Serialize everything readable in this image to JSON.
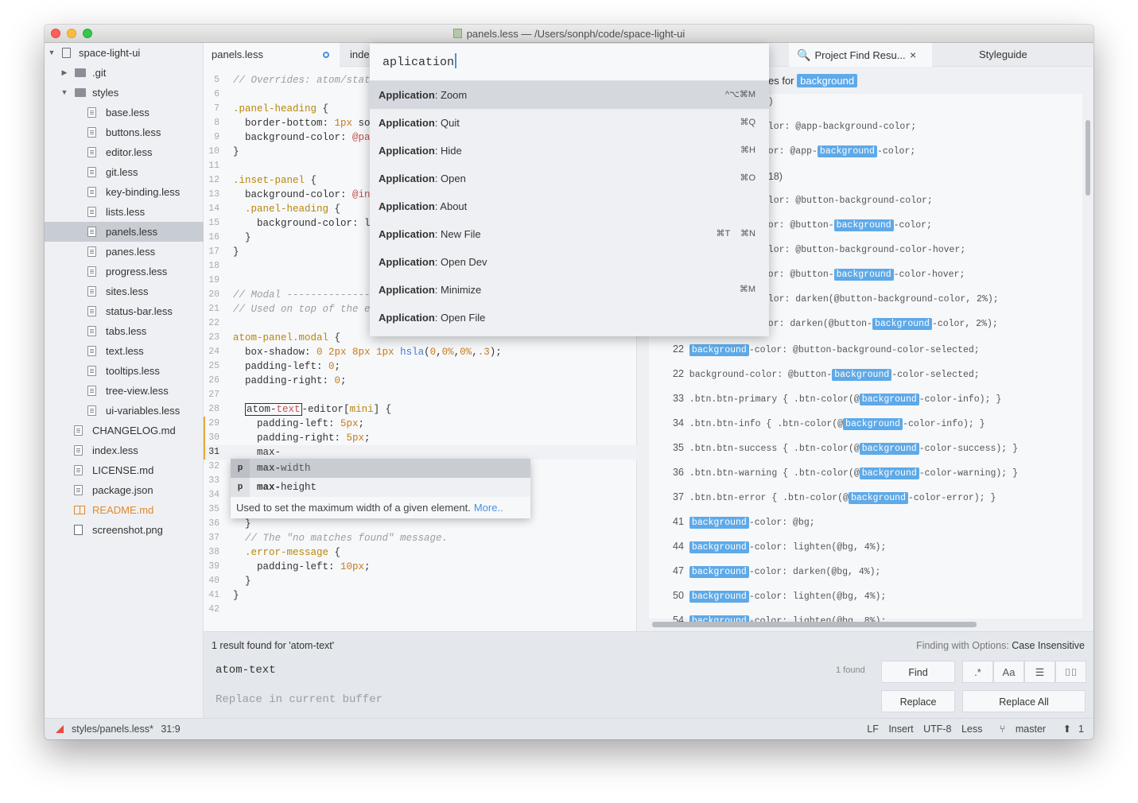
{
  "window": {
    "title": "panels.less — /Users/sonph/code/space-light-ui"
  },
  "sidebar": {
    "root": "space-light-ui",
    "items": [
      {
        "label": ".git",
        "kind": "folder",
        "depth": 1,
        "chev": "▶"
      },
      {
        "label": "styles",
        "kind": "folder",
        "depth": 1,
        "chev": "▼"
      },
      {
        "label": "base.less",
        "kind": "file",
        "depth": 2
      },
      {
        "label": "buttons.less",
        "kind": "file",
        "depth": 2
      },
      {
        "label": "editor.less",
        "kind": "file",
        "depth": 2
      },
      {
        "label": "git.less",
        "kind": "file",
        "depth": 2
      },
      {
        "label": "key-binding.less",
        "kind": "file",
        "depth": 2
      },
      {
        "label": "lists.less",
        "kind": "file",
        "depth": 2
      },
      {
        "label": "panels.less",
        "kind": "file",
        "depth": 2,
        "selected": true
      },
      {
        "label": "panes.less",
        "kind": "file",
        "depth": 2
      },
      {
        "label": "progress.less",
        "kind": "file",
        "depth": 2
      },
      {
        "label": "sites.less",
        "kind": "file",
        "depth": 2
      },
      {
        "label": "status-bar.less",
        "kind": "file",
        "depth": 2
      },
      {
        "label": "tabs.less",
        "kind": "file",
        "depth": 2
      },
      {
        "label": "text.less",
        "kind": "file",
        "depth": 2
      },
      {
        "label": "tooltips.less",
        "kind": "file",
        "depth": 2
      },
      {
        "label": "tree-view.less",
        "kind": "file",
        "depth": 2
      },
      {
        "label": "ui-variables.less",
        "kind": "file",
        "depth": 2
      },
      {
        "label": "CHANGELOG.md",
        "kind": "file",
        "depth": 1
      },
      {
        "label": "index.less",
        "kind": "file",
        "depth": 1
      },
      {
        "label": "LICENSE.md",
        "kind": "file",
        "depth": 1
      },
      {
        "label": "package.json",
        "kind": "file",
        "depth": 1
      },
      {
        "label": "README.md",
        "kind": "readme",
        "depth": 1
      },
      {
        "label": "screenshot.png",
        "kind": "image",
        "depth": 1
      }
    ]
  },
  "editor": {
    "tabs": [
      {
        "label": "panels.less",
        "active": true,
        "modified": true
      },
      {
        "label": "index"
      }
    ],
    "lines": [
      {
        "n": "5",
        "html": "<span class='c-comment'>// Overrides: atom/stati</span>"
      },
      {
        "n": "6",
        "html": ""
      },
      {
        "n": "7",
        "html": "<span class='c-sel'>.panel-heading</span> {"
      },
      {
        "n": "8",
        "html": "  border-bottom: <span class='c-num'>1px</span> sol"
      },
      {
        "n": "9",
        "html": "  background-color: <span class='c-var'>@pan</span>"
      },
      {
        "n": "10",
        "html": "}"
      },
      {
        "n": "11",
        "html": ""
      },
      {
        "n": "12",
        "html": "<span class='c-sel'>.inset-panel</span> {"
      },
      {
        "n": "13",
        "html": "  background-color: <span class='c-var'>@ins</span>"
      },
      {
        "n": "14",
        "html": "  <span class='c-sel'>.panel-heading</span> {"
      },
      {
        "n": "15",
        "html": "    background-color: li"
      },
      {
        "n": "16",
        "html": "  }"
      },
      {
        "n": "17",
        "html": "}"
      },
      {
        "n": "18",
        "html": ""
      },
      {
        "n": "19",
        "html": ""
      },
      {
        "n": "20",
        "html": "<span class='c-comment'>// Modal -----------------</span>"
      },
      {
        "n": "21",
        "html": "<span class='c-comment'>// Used on top of the ed</span>"
      },
      {
        "n": "22",
        "html": ""
      },
      {
        "n": "23",
        "html": "<span class='c-tag'>atom-panel.modal</span> {"
      },
      {
        "n": "24",
        "html": "  box-shadow: <span class='c-num'>0 2px 8px 1px</span> <span class='c-fn'>hsla</span>(<span class='c-num'>0</span>,<span class='c-num'>0%</span>,<span class='c-num'>0%</span>,<span class='c-num'>.3</span>);"
      },
      {
        "n": "25",
        "html": "  padding-left: <span class='c-num'>0</span>;"
      },
      {
        "n": "26",
        "html": "  padding-right: <span class='c-num'>0</span>;"
      },
      {
        "n": "27",
        "html": ""
      },
      {
        "n": "28",
        "html": "  <span class='search-hl'>atom-<span class='c-var'>text</span></span>-editor[<span class='c-tag'>mini</span>] {"
      },
      {
        "n": "29",
        "html": "    padding-left: <span class='c-num'>5px</span>;",
        "modified": true
      },
      {
        "n": "30",
        "html": "    padding-right: <span class='c-num'>5px</span>;",
        "modified": true
      },
      {
        "n": "31",
        "html": "    max-",
        "modified": true,
        "cursor": true
      },
      {
        "n": "32",
        "html": ""
      },
      {
        "n": "33",
        "html": ""
      },
      {
        "n": "34",
        "html": ""
      },
      {
        "n": "35",
        "html": ""
      },
      {
        "n": "36",
        "html": "  }"
      },
      {
        "n": "37",
        "html": "  <span class='c-comment'>// The \"no matches found\" message.</span>"
      },
      {
        "n": "38",
        "html": "  <span class='c-sel'>.error-message</span> {"
      },
      {
        "n": "39",
        "html": "    padding-left: <span class='c-num'>10px</span>;"
      },
      {
        "n": "40",
        "html": "  }"
      },
      {
        "n": "41",
        "html": "}"
      },
      {
        "n": "42",
        "html": ""
      }
    ]
  },
  "palette": {
    "query": "aplication",
    "items": [
      {
        "bold": "Application",
        "rest": ": Zoom",
        "kbd": "^⌥⌘M",
        "selected": true
      },
      {
        "bold": "Application",
        "rest": ": Quit",
        "kbd": "⌘Q"
      },
      {
        "bold": "Application",
        "rest": ": Hide",
        "kbd": "⌘H"
      },
      {
        "bold": "Application",
        "rest": ": Open",
        "kbd": "⌘O"
      },
      {
        "bold": "Application",
        "rest": ": About",
        "kbd": ""
      },
      {
        "bold": "Application",
        "rest": ": New File",
        "kbd": "⌘T ⌘N"
      },
      {
        "bold": "Application",
        "rest": ": Open Dev",
        "kbd": ""
      },
      {
        "bold": "Application",
        "rest": ": Minimize",
        "kbd": "⌘M"
      },
      {
        "bold": "Application",
        "rest": ": Open File",
        "kbd": ""
      }
    ]
  },
  "autocomplete": {
    "items": [
      {
        "type": "p",
        "text": "max-width",
        "selected": true
      },
      {
        "type": "p",
        "text": "max-height"
      }
    ],
    "description": "Used to set the maximum width of a given element.",
    "more": "More.."
  },
  "results": {
    "tabs": [
      {
        "label": "Project Find Resu..."
      },
      {
        "label": "Styleguide"
      }
    ],
    "header_prefix": "es for",
    "search_term": "background",
    "lines": [
      {
        "html": "(2)"
      },
      {
        "html": "color: @app-background-color;"
      },
      {
        "html": "olor: @app-<span class='match'>background</span>-color;"
      },
      {
        "html": "<span class='rl-num'>s  (18)</span>"
      },
      {
        "html": "color: @button-background-color;"
      },
      {
        "html": "olor: @button-<span class='match'>background</span>-color;"
      },
      {
        "html": "color: @button-background-color-hover;"
      },
      {
        "html": "olor: @button-<span class='match'>background</span>-color-hover;"
      },
      {
        "html": "color: darken(@button-background-color, 2%);"
      },
      {
        "html": "olor: darken(@button-<span class='match'>background</span>-color, 2%);"
      },
      {
        "html": "<span class='rl-num'>22</span> <span class='match'>background</span>-color: @button-background-color-selected;"
      },
      {
        "html": "<span class='rl-num'>22</span> background-color: @button-<span class='match'>background</span>-color-selected;"
      },
      {
        "html": "<span class='rl-num'>33</span> .btn.btn-primary { .btn-color(@<span class='match'>background</span>-color-info); }"
      },
      {
        "html": "<span class='rl-num'>34</span> .btn.btn-info { .btn-color(@<span class='match'>background</span>-color-info); }"
      },
      {
        "html": "<span class='rl-num'>35</span> .btn.btn-success { .btn-color(@<span class='match'>background</span>-color-success); }"
      },
      {
        "html": "<span class='rl-num'>36</span> .btn.btn-warning { .btn-color(@<span class='match'>background</span>-color-warning); }"
      },
      {
        "html": "<span class='rl-num'>37</span> .btn.btn-error { .btn-color(@<span class='match'>background</span>-color-error); }"
      },
      {
        "html": "<span class='rl-num'>41</span> <span class='match'>background</span>-color: @bg;"
      },
      {
        "html": "<span class='rl-num'>44</span> <span class='match'>background</span>-color: lighten(@bg, 4%);"
      },
      {
        "html": "<span class='rl-num'>47</span> <span class='match'>background</span>-color: darken(@bg, 4%);"
      },
      {
        "html": "<span class='rl-num'>50</span> <span class='match'>background</span>-color: lighten(@bg, 4%);"
      },
      {
        "html": "<span class='rl-num'>54</span> <span class='match'>background</span>-color: lighten(@bg, 8%);"
      }
    ]
  },
  "find": {
    "status": "1 result found for 'atom-text'",
    "options_label": "Finding with Options:",
    "options_value": "Case Insensitive",
    "find_value": "atom-text",
    "replace_placeholder": "Replace in current buffer",
    "found_count": "1 found",
    "find_button": "Find",
    "replace_button": "Replace",
    "replace_all_button": "Replace All",
    "regex_label": ".*",
    "case_label": "Aa"
  },
  "status": {
    "path": "styles/panels.less*",
    "position": "31:9",
    "line_ending": "LF",
    "mode": "Insert",
    "encoding": "UTF-8",
    "grammar": "Less",
    "branch": "master",
    "ahead": "1"
  }
}
